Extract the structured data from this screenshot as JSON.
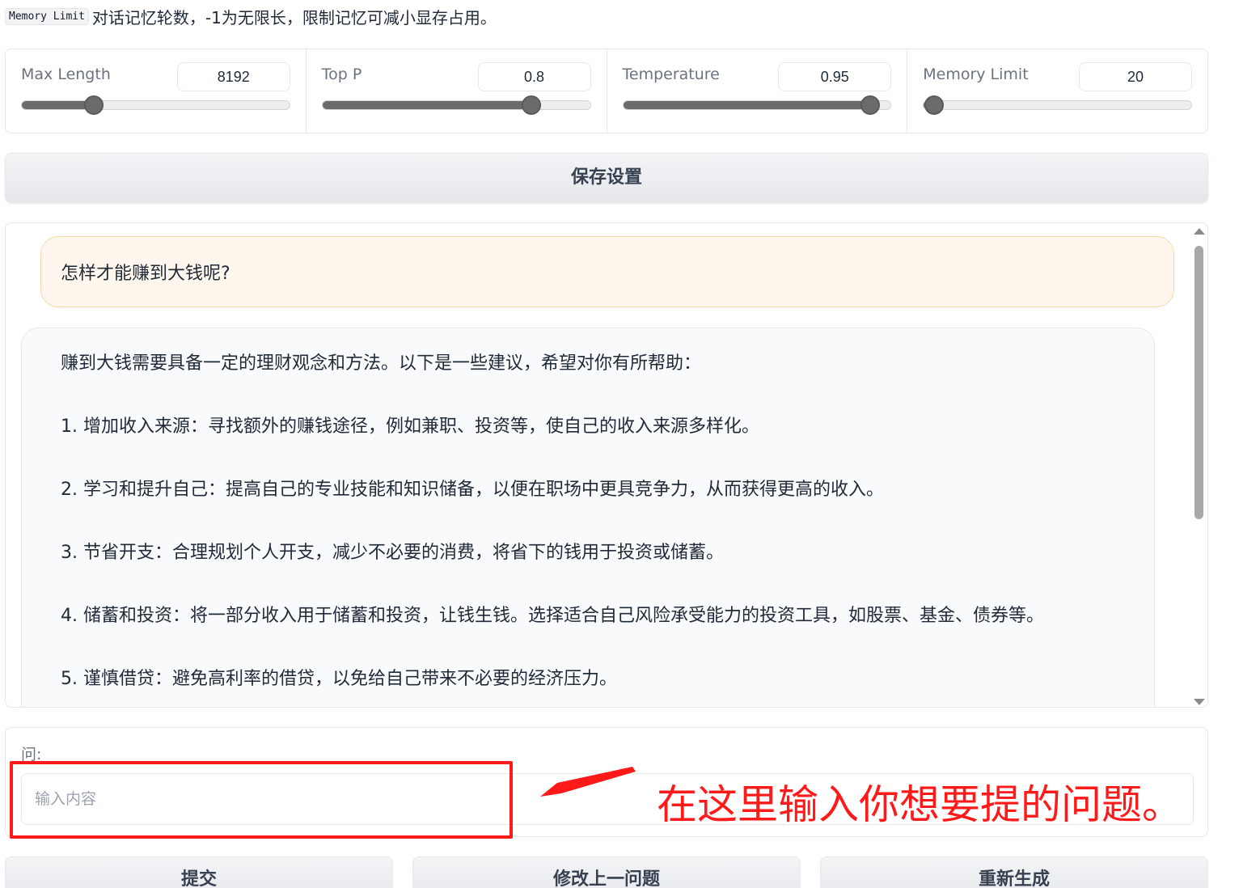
{
  "hint": {
    "code": "Memory Limit",
    "text": "对话记忆轮数，-1为无限长，限制记忆可减小显存占用。"
  },
  "sliders": [
    {
      "label": "Max Length",
      "value": "8192",
      "fraction": 0.27
    },
    {
      "label": "Top P",
      "value": "0.8",
      "fraction": 0.78
    },
    {
      "label": "Temperature",
      "value": "0.95",
      "fraction": 0.92
    },
    {
      "label": "Memory Limit",
      "value": "20",
      "fraction": 0.04
    }
  ],
  "save_button": "保存设置",
  "chat": {
    "user_message": "怎样才能赚到大钱呢?",
    "bot_lines": [
      "赚到大钱需要具备一定的理财观念和方法。以下是一些建议，希望对你有所帮助：",
      "1. 增加收入来源：寻找额外的赚钱途径，例如兼职、投资等，使自己的收入来源多样化。",
      "2. 学习和提升自己：提高自己的专业技能和知识储备，以便在职场中更具竞争力，从而获得更高的收入。",
      "3. 节省开支：合理规划个人开支，减少不必要的消费，将省下的钱用于投资或储蓄。",
      "4. 储蓄和投资：将一部分收入用于储蓄和投资，让钱生钱。选择适合自己风险承受能力的投资工具，如股票、基金、债券等。",
      "5. 谨慎借贷：避免高利率的借贷，以免给自己带来不必要的经济压力。"
    ]
  },
  "input": {
    "label": "问:",
    "placeholder": "输入内容",
    "value": ""
  },
  "annotation": {
    "text": "在这里输入你想要提的问题。",
    "color": "#ff1a1a"
  },
  "buttons": {
    "submit": "提交",
    "edit_last": "修改上一问题",
    "regenerate": "重新生成"
  }
}
